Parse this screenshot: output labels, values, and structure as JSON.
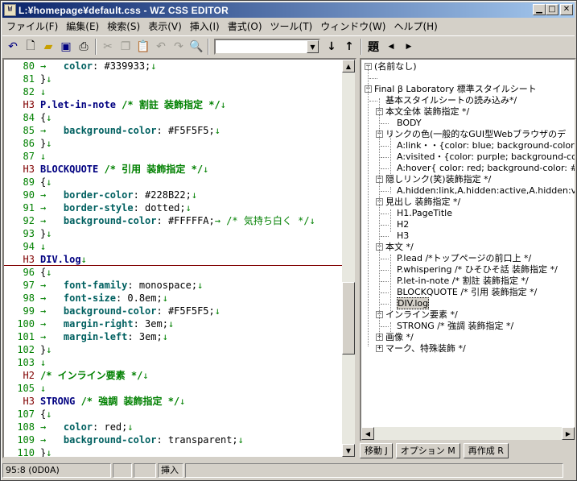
{
  "window": {
    "title": "L:¥homepage¥default.css - WZ CSS EDITOR",
    "icon_text": "W"
  },
  "menu": [
    "ファイル(F)",
    "編集(E)",
    "検索(S)",
    "表示(V)",
    "挿入(I)",
    "書式(O)",
    "ツール(T)",
    "ウィンドウ(W)",
    "ヘルプ(H)"
  ],
  "toolbar": {
    "heading_label": "題",
    "search_value": ""
  },
  "editor": {
    "lines": [
      {
        "n": "80",
        "parts": [
          {
            "c": "ms",
            "t": "→   "
          },
          {
            "c": "kw",
            "t": "color"
          },
          {
            "c": "val",
            "t": ": #339933;"
          },
          {
            "c": "ms",
            "t": "↓"
          }
        ]
      },
      {
        "n": "81",
        "parts": [
          {
            "c": "val",
            "t": "}"
          },
          {
            "c": "ms",
            "t": "↓"
          }
        ]
      },
      {
        "n": "82",
        "parts": [
          {
            "c": "ms",
            "t": "↓"
          }
        ]
      },
      {
        "n": "H3",
        "parts": [
          {
            "c": "sel",
            "t": "P.let-in-note "
          },
          {
            "c": "cm",
            "t": "/* 割註 装飾指定 */"
          },
          {
            "c": "ms",
            "t": "↓"
          }
        ]
      },
      {
        "n": "84",
        "parts": [
          {
            "c": "val",
            "t": "{"
          },
          {
            "c": "ms",
            "t": "↓"
          }
        ]
      },
      {
        "n": "85",
        "parts": [
          {
            "c": "ms",
            "t": "→   "
          },
          {
            "c": "kw",
            "t": "background-color"
          },
          {
            "c": "val",
            "t": ": #F5F5F5;"
          },
          {
            "c": "ms",
            "t": "↓"
          }
        ]
      },
      {
        "n": "86",
        "parts": [
          {
            "c": "val",
            "t": "}"
          },
          {
            "c": "ms",
            "t": "↓"
          }
        ]
      },
      {
        "n": "87",
        "parts": [
          {
            "c": "ms",
            "t": "↓"
          }
        ]
      },
      {
        "n": "H3",
        "parts": [
          {
            "c": "sel",
            "t": "BLOCKQUOTE "
          },
          {
            "c": "cm",
            "t": "/* 引用 装飾指定 */"
          },
          {
            "c": "ms",
            "t": "↓"
          }
        ]
      },
      {
        "n": "89",
        "parts": [
          {
            "c": "val",
            "t": "{"
          },
          {
            "c": "ms",
            "t": "↓"
          }
        ]
      },
      {
        "n": "90",
        "parts": [
          {
            "c": "ms",
            "t": "→   "
          },
          {
            "c": "kw",
            "t": "border-color"
          },
          {
            "c": "val",
            "t": ": #228B22;"
          },
          {
            "c": "ms",
            "t": "↓"
          }
        ]
      },
      {
        "n": "91",
        "parts": [
          {
            "c": "ms",
            "t": "→   "
          },
          {
            "c": "kw",
            "t": "border-style"
          },
          {
            "c": "val",
            "t": ": dotted;"
          },
          {
            "c": "ms",
            "t": "↓"
          }
        ]
      },
      {
        "n": "92",
        "parts": [
          {
            "c": "ms",
            "t": "→   "
          },
          {
            "c": "kw",
            "t": "background-color"
          },
          {
            "c": "val",
            "t": ": #FFFFFA;"
          },
          {
            "c": "ms",
            "t": "→ "
          },
          {
            "c": "ms",
            "t": "/* 気持ち白く */"
          },
          {
            "c": "ms",
            "t": "↓"
          }
        ]
      },
      {
        "n": "93",
        "parts": [
          {
            "c": "val",
            "t": "}"
          },
          {
            "c": "ms",
            "t": "↓"
          }
        ]
      },
      {
        "n": "94",
        "parts": [
          {
            "c": "ms",
            "t": "↓"
          }
        ]
      },
      {
        "n": "H3",
        "parts": [
          {
            "c": "sel",
            "t": "DIV.log"
          },
          {
            "c": "ms",
            "t": "↓"
          }
        ]
      },
      {
        "n": "96",
        "parts": [
          {
            "c": "val",
            "t": "{"
          },
          {
            "c": "ms",
            "t": "↓"
          }
        ]
      },
      {
        "n": "97",
        "parts": [
          {
            "c": "ms",
            "t": "→   "
          },
          {
            "c": "kw",
            "t": "font-family"
          },
          {
            "c": "val",
            "t": ": monospace;"
          },
          {
            "c": "ms",
            "t": "↓"
          }
        ]
      },
      {
        "n": "98",
        "parts": [
          {
            "c": "ms",
            "t": "→   "
          },
          {
            "c": "kw",
            "t": "font-size"
          },
          {
            "c": "val",
            "t": ": 0.8em;"
          },
          {
            "c": "ms",
            "t": "↓"
          }
        ]
      },
      {
        "n": "99",
        "parts": [
          {
            "c": "ms",
            "t": "→   "
          },
          {
            "c": "kw",
            "t": "background-color"
          },
          {
            "c": "val",
            "t": ": #F5F5F5;"
          },
          {
            "c": "ms",
            "t": "↓"
          }
        ]
      },
      {
        "n": "100",
        "parts": [
          {
            "c": "ms",
            "t": "→   "
          },
          {
            "c": "kw",
            "t": "margin-right"
          },
          {
            "c": "val",
            "t": ": 3em;"
          },
          {
            "c": "ms",
            "t": "↓"
          }
        ]
      },
      {
        "n": "101",
        "parts": [
          {
            "c": "ms",
            "t": "→   "
          },
          {
            "c": "kw",
            "t": "margin-left"
          },
          {
            "c": "val",
            "t": ": 3em;"
          },
          {
            "c": "ms",
            "t": "↓"
          }
        ]
      },
      {
        "n": "102",
        "parts": [
          {
            "c": "val",
            "t": "}"
          },
          {
            "c": "ms",
            "t": "↓"
          }
        ]
      },
      {
        "n": "103",
        "parts": [
          {
            "c": "ms",
            "t": "↓"
          }
        ]
      },
      {
        "n": "H2",
        "parts": [
          {
            "c": "cm",
            "t": "/* インライン要素 */"
          },
          {
            "c": "ms",
            "t": "↓"
          }
        ]
      },
      {
        "n": "105",
        "parts": [
          {
            "c": "ms",
            "t": "↓"
          }
        ]
      },
      {
        "n": "H3",
        "parts": [
          {
            "c": "sel",
            "t": "STRONG "
          },
          {
            "c": "cm",
            "t": "/* 強調 装飾指定 */"
          },
          {
            "c": "ms",
            "t": "↓"
          }
        ]
      },
      {
        "n": "107",
        "parts": [
          {
            "c": "val",
            "t": "{"
          },
          {
            "c": "ms",
            "t": "↓"
          }
        ]
      },
      {
        "n": "108",
        "parts": [
          {
            "c": "ms",
            "t": "→   "
          },
          {
            "c": "kw",
            "t": "color"
          },
          {
            "c": "val",
            "t": ": red;"
          },
          {
            "c": "ms",
            "t": "↓"
          }
        ]
      },
      {
        "n": "109",
        "parts": [
          {
            "c": "ms",
            "t": "→   "
          },
          {
            "c": "kw",
            "t": "background-color"
          },
          {
            "c": "val",
            "t": ": transparent;"
          },
          {
            "c": "ms",
            "t": "↓"
          }
        ]
      },
      {
        "n": "110",
        "parts": [
          {
            "c": "val",
            "t": "}"
          },
          {
            "c": "ms",
            "t": "↓"
          }
        ]
      }
    ]
  },
  "tree": {
    "nodes": [
      {
        "d": 0,
        "exp": "-",
        "t": "(名前なし)"
      },
      {
        "d": 1,
        "exp": "",
        "t": ""
      },
      {
        "d": 0,
        "exp": "-",
        "t": "Final β Laboratory 標準スタイルシート"
      },
      {
        "d": 1,
        "exp": "",
        "t": "基本スタイルシートの読み込み*/"
      },
      {
        "d": 1,
        "exp": "-",
        "t": "本文全体 装飾指定 */"
      },
      {
        "d": 2,
        "exp": "",
        "t": "BODY"
      },
      {
        "d": 1,
        "exp": "-",
        "t": "リンクの色(一般的なGUI型Webブラウザのデ"
      },
      {
        "d": 2,
        "exp": "",
        "t": "A:link・・{color: blue; background-color: tra"
      },
      {
        "d": 2,
        "exp": "",
        "t": "A:visited・{color: purple; background-colo"
      },
      {
        "d": 2,
        "exp": "",
        "t": "A:hover{ color: red; background-color: #D"
      },
      {
        "d": 1,
        "exp": "-",
        "t": "隠しリンク(笑)装飾指定 */"
      },
      {
        "d": 2,
        "exp": "",
        "t": "A.hidden:link,A.hidden:active,A.hidden:visi"
      },
      {
        "d": 1,
        "exp": "-",
        "t": "見出し 装飾指定 */"
      },
      {
        "d": 2,
        "exp": "",
        "t": "H1.PageTitle"
      },
      {
        "d": 2,
        "exp": "",
        "t": "H2"
      },
      {
        "d": 2,
        "exp": "",
        "t": "H3"
      },
      {
        "d": 1,
        "exp": "-",
        "t": "本文 */"
      },
      {
        "d": 2,
        "exp": "",
        "t": "P.lead /*トップページの前口上 */"
      },
      {
        "d": 2,
        "exp": "",
        "t": "P.whispering /* ひそひそ話 装飾指定 */"
      },
      {
        "d": 2,
        "exp": "",
        "t": "P.let-in-note /* 割註 装飾指定 */"
      },
      {
        "d": 2,
        "exp": "",
        "t": "BLOCKQUOTE /* 引用 装飾指定 */"
      },
      {
        "d": 2,
        "exp": "",
        "t": "DIV.log",
        "sel": true
      },
      {
        "d": 1,
        "exp": "-",
        "t": "インライン要素 */"
      },
      {
        "d": 2,
        "exp": "",
        "t": "STRONG /* 強調 装飾指定 */"
      },
      {
        "d": 1,
        "exp": "+",
        "t": "画像 */"
      },
      {
        "d": 1,
        "exp": "+",
        "t": "マーク、特殊装飾 */"
      }
    ]
  },
  "panel_buttons": [
    "移動 J",
    "オプション M",
    "再作成 R"
  ],
  "status": {
    "position": "95:8 (0D0A)",
    "pane2": "",
    "pane3": "",
    "mode": "挿入",
    "pane5": ""
  }
}
